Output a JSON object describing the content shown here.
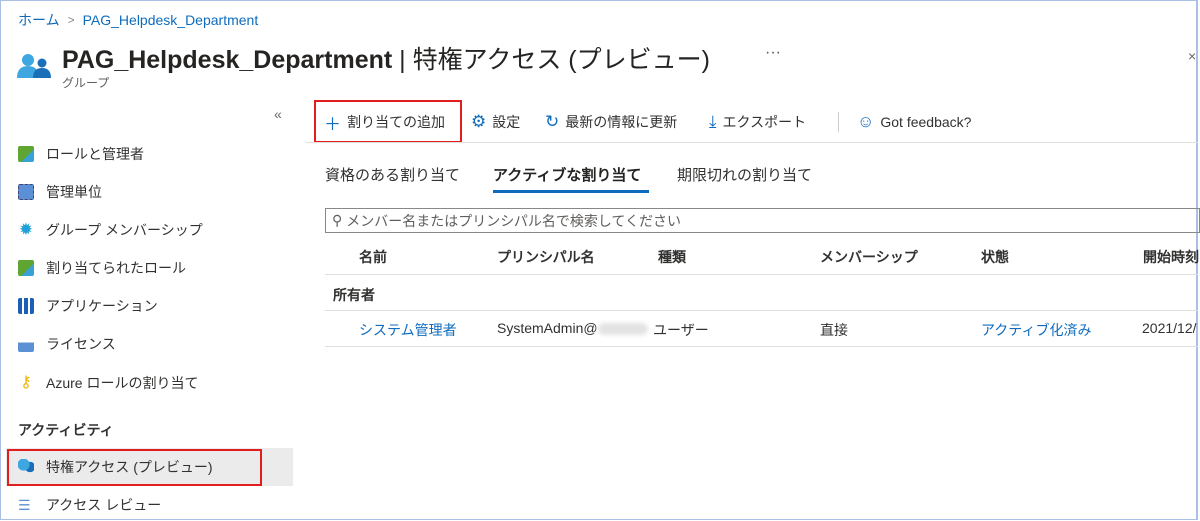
{
  "breadcrumb": {
    "home": "ホーム",
    "current": "PAG_Helpdesk_Department"
  },
  "header": {
    "title": "PAG_Helpdesk_Department",
    "title_suffix": " | 特権アクセス (プレビュー)",
    "subtitle": "グループ",
    "more": "···"
  },
  "sidebar": {
    "collapse": "«",
    "items": [
      {
        "label": "ロールと管理者",
        "icon": "role-user-icon"
      },
      {
        "label": "管理単位",
        "icon": "admin-unit-icon"
      },
      {
        "label": "グループ メンバーシップ",
        "icon": "gear-icon"
      },
      {
        "label": "割り当てられたロール",
        "icon": "role-user-icon"
      },
      {
        "label": "アプリケーション",
        "icon": "apps-grid-icon"
      },
      {
        "label": "ライセンス",
        "icon": "license-icon"
      },
      {
        "label": "Azure ロールの割り当て",
        "icon": "key-icon"
      }
    ],
    "section": "アクティビティ",
    "activity": [
      {
        "label": "特権アクセス (プレビュー)",
        "icon": "group-icon",
        "selected": true
      },
      {
        "label": "アクセス レビュー",
        "icon": "checklist-icon"
      }
    ]
  },
  "toolbar": {
    "add": "割り当ての追加",
    "settings": "設定",
    "refresh": "最新の情報に更新",
    "export": "エクスポート",
    "feedback": "Got feedback?"
  },
  "tabs": [
    {
      "label": "資格のある割り当て"
    },
    {
      "label": "アクティブな割り当て",
      "active": true
    },
    {
      "label": "期限切れの割り当て"
    }
  ],
  "search": {
    "placeholder": "メンバー名またはプリンシパル名で検索してください"
  },
  "table": {
    "headers": [
      "名前",
      "プリンシパル名",
      "種類",
      "メンバーシップ",
      "状態",
      "開始時刻"
    ],
    "group": "所有者",
    "rows": [
      {
        "name": "システム管理者",
        "principal": "SystemAdmin@",
        "type": "ユーザー",
        "membership": "直接",
        "state": "アクティブ化済み",
        "start": "2021/12/"
      }
    ]
  },
  "colors": {
    "accent": "#0f6cbd",
    "highlight": "#e01e1e"
  }
}
